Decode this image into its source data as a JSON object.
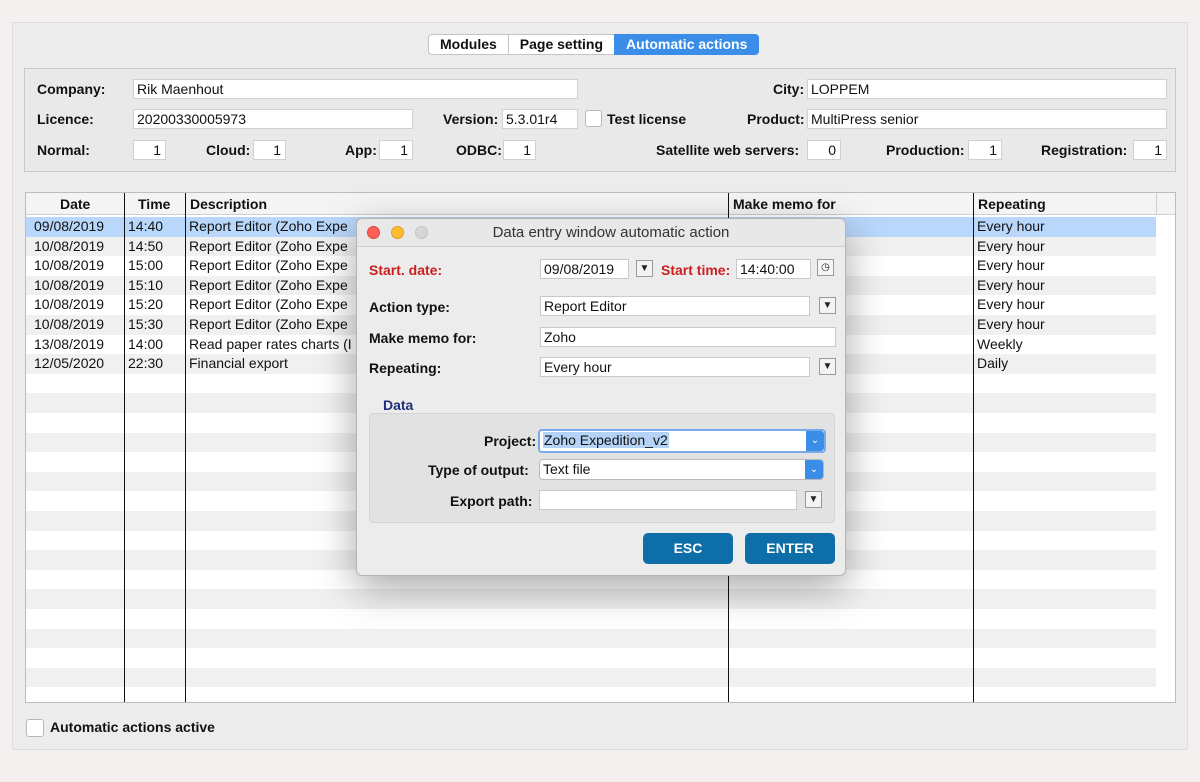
{
  "tabs": [
    {
      "label": "Modules",
      "active": false
    },
    {
      "label": "Page setting",
      "active": false
    },
    {
      "label": "Automatic actions",
      "active": true
    }
  ],
  "info": {
    "company_label": "Company:",
    "company": "Rik Maenhout",
    "city_label": "City:",
    "city": "LOPPEM",
    "licence_label": "Licence:",
    "licence": "20200330005973",
    "version_label": "Version:",
    "version": "5.3.01r4",
    "test_license_label": "Test license",
    "product_label": "Product:",
    "product": "MultiPress senior",
    "normal_label": "Normal:",
    "normal": "1",
    "cloud_label": "Cloud:",
    "cloud": "1",
    "app_label": "App:",
    "app": "1",
    "odbc_label": "ODBC:",
    "odbc": "1",
    "satellite_label": "Satellite web servers:",
    "satellite": "0",
    "production_label": "Production:",
    "production": "1",
    "registration_label": "Registration:",
    "registration": "1"
  },
  "table": {
    "headers": [
      "Date",
      "Time",
      "Description",
      "Make memo for",
      "Repeating"
    ],
    "rows": [
      [
        "09/08/2019",
        "14:40",
        "Report Editor (Zoho Expe",
        "",
        "Every hour"
      ],
      [
        "10/08/2019",
        "14:50",
        "Report Editor (Zoho Expe",
        "",
        "Every hour"
      ],
      [
        "10/08/2019",
        "15:00",
        "Report Editor (Zoho Expe",
        "",
        "Every hour"
      ],
      [
        "10/08/2019",
        "15:10",
        "Report Editor (Zoho Expe",
        "",
        "Every hour"
      ],
      [
        "10/08/2019",
        "15:20",
        "Report Editor (Zoho Expe",
        "",
        "Every hour"
      ],
      [
        "10/08/2019",
        "15:30",
        "Report Editor (Zoho Expe",
        "",
        "Every hour"
      ],
      [
        "13/08/2019",
        "14:00",
        "Read paper rates charts (I",
        "",
        "Weekly"
      ],
      [
        "12/05/2020",
        "22:30",
        "Financial export",
        "",
        "Daily"
      ]
    ]
  },
  "bottom": {
    "automatic_actions_label": "Automatic actions active"
  },
  "dialog": {
    "title": "Data entry window automatic action",
    "start_date_label": "Start. date:",
    "start_date": "09/08/2019",
    "start_time_label": "Start time:",
    "start_time": "14:40:00",
    "action_type_label": "Action type:",
    "action_type": "Report Editor",
    "memo_label": "Make memo for:",
    "memo": "Zoho",
    "repeating_label": "Repeating:",
    "repeating": "Every hour",
    "data_group_label": "Data",
    "project_label": "Project:",
    "project": "Zoho Expedition_v2",
    "output_label": "Type of output:",
    "output": "Text file",
    "export_label": "Export path:",
    "export": "",
    "esc_label": "ESC",
    "enter_label": "ENTER"
  },
  "colors": {
    "accent": "#3b8ee8",
    "button": "#0e6ea8",
    "required_label": "#c9201f",
    "selection": "#b8d7fb"
  }
}
